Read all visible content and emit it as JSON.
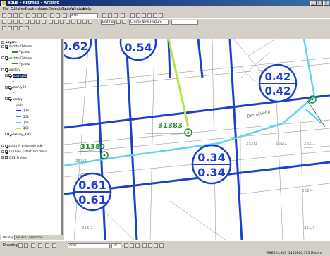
{
  "window": {
    "title": "aqua - ArcMap - ArcInfo"
  },
  "menu": [
    "File",
    "Edit",
    "View",
    "Bookmarks",
    "Insert",
    "Selection",
    "Tools",
    "Window",
    "Help"
  ],
  "toolbar": {
    "scale_value": "410",
    "editor_label": "Editing",
    "task_value": "Create New Feature"
  },
  "toc": {
    "root": "Layers",
    "items": [
      {
        "label": "sachty.61dmna",
        "level": 1,
        "checked": true,
        "expander": "-"
      },
      {
        "label": "Vychozi",
        "level": 3,
        "checked": false,
        "swatch": "#3c8c3c"
      },
      {
        "label": "sachty.62dmna",
        "level": 1,
        "checked": true,
        "expander": "-"
      },
      {
        "label": "Vychozi",
        "level": 3,
        "checked": false,
        "swatch": "#3c8c3c"
      },
      {
        "label": "vektory",
        "level": 1,
        "checked": true,
        "expander": "-"
      },
      {
        "label": "sachty01",
        "level": 2,
        "checked": true,
        "expander": "-",
        "selected": true
      },
      {
        "label": "+",
        "level": 3,
        "checked": false
      },
      {
        "label": "sachty02",
        "level": 2,
        "checked": true,
        "expander": "-"
      },
      {
        "label": "+",
        "level": 3,
        "checked": false
      },
      {
        "label": "kanaly",
        "level": 2,
        "checked": true,
        "expander": "-"
      },
      {
        "label": "druh",
        "level": 4,
        "checked": false
      },
      {
        "label": "Q09",
        "level": 4,
        "checked": false,
        "swatch": "#1e46c8"
      },
      {
        "label": "Q03",
        "level": 4,
        "checked": false,
        "swatch": "#3c8cdc"
      },
      {
        "label": "Q62",
        "level": 4,
        "checked": false,
        "swatch": "#64c8f0"
      },
      {
        "label": "Q63",
        "level": 4,
        "checked": false,
        "swatch": "#b4e646"
      },
      {
        "label": "okruhy_data",
        "level": 2,
        "checked": true,
        "expander": "-"
      },
      {
        "label": "",
        "level": 3,
        "checked": false,
        "swatch": "#1e46c8"
      },
      {
        "label": "ceste_li_pribeh(de_sde",
        "level": 1,
        "checked": true,
        "expander": "+"
      },
      {
        "label": "DCU29 - katastralni mapa",
        "level": 1,
        "checked": true,
        "expander": "+"
      },
      {
        "label": "Q11_Project",
        "level": 1,
        "checked": false,
        "expander": "+"
      }
    ]
  },
  "toc_tabs": [
    "Display",
    "Source",
    "Selection"
  ],
  "map": {
    "pipe_labels": [
      "31383",
      "31380"
    ],
    "circle_labels": [
      {
        "top": "0.62"
      },
      {
        "top": "0.54"
      },
      {
        "top": "0.42",
        "bottom": "0.42"
      },
      {
        "top": "0.34",
        "bottom": "0.34"
      },
      {
        "top": "0.61",
        "bottom": "0.61"
      }
    ],
    "parcel_labels": [
      "252/3",
      "252/1",
      "254/1",
      "253/2",
      "252/4",
      "251/2",
      "255/1",
      "251/1"
    ],
    "street_label": "Botničkeho"
  },
  "drawing": {
    "label": "Drawing",
    "font": "Arial",
    "size": "10"
  },
  "status": {
    "coords": "-996624,303  -1150800,595 Meters"
  }
}
